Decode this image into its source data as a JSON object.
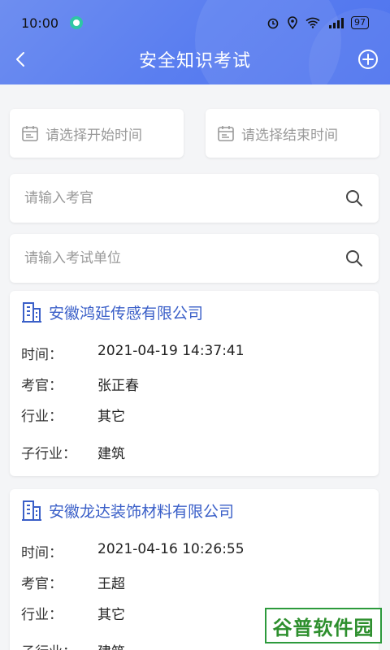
{
  "status": {
    "time": "10:00",
    "battery": "97"
  },
  "nav": {
    "title": "安全知识考试"
  },
  "filters": {
    "start_placeholder": "请选择开始时间",
    "end_placeholder": "请选择结束时间",
    "examiner_placeholder": "请输入考官",
    "unit_placeholder": "请输入考试单位"
  },
  "labels": {
    "time": "时间：",
    "examiner": "考官：",
    "industry": "行业：",
    "sub_industry": "子行业："
  },
  "records": [
    {
      "company": "安徽鸿延传感有限公司",
      "time": "2021-04-19 14:37:41",
      "examiner": "张正春",
      "industry": "其它",
      "sub_industry": "建筑"
    },
    {
      "company": "安徽龙达装饰材料有限公司",
      "time": "2021-04-16 10:26:55",
      "examiner": "王超",
      "industry": "其它",
      "sub_industry": "建筑"
    }
  ],
  "watermark": {
    "text": "谷普软件园"
  },
  "colors": {
    "header": "#5a7ef0",
    "company": "#3a5fc8",
    "background": "#f4f5f7"
  }
}
